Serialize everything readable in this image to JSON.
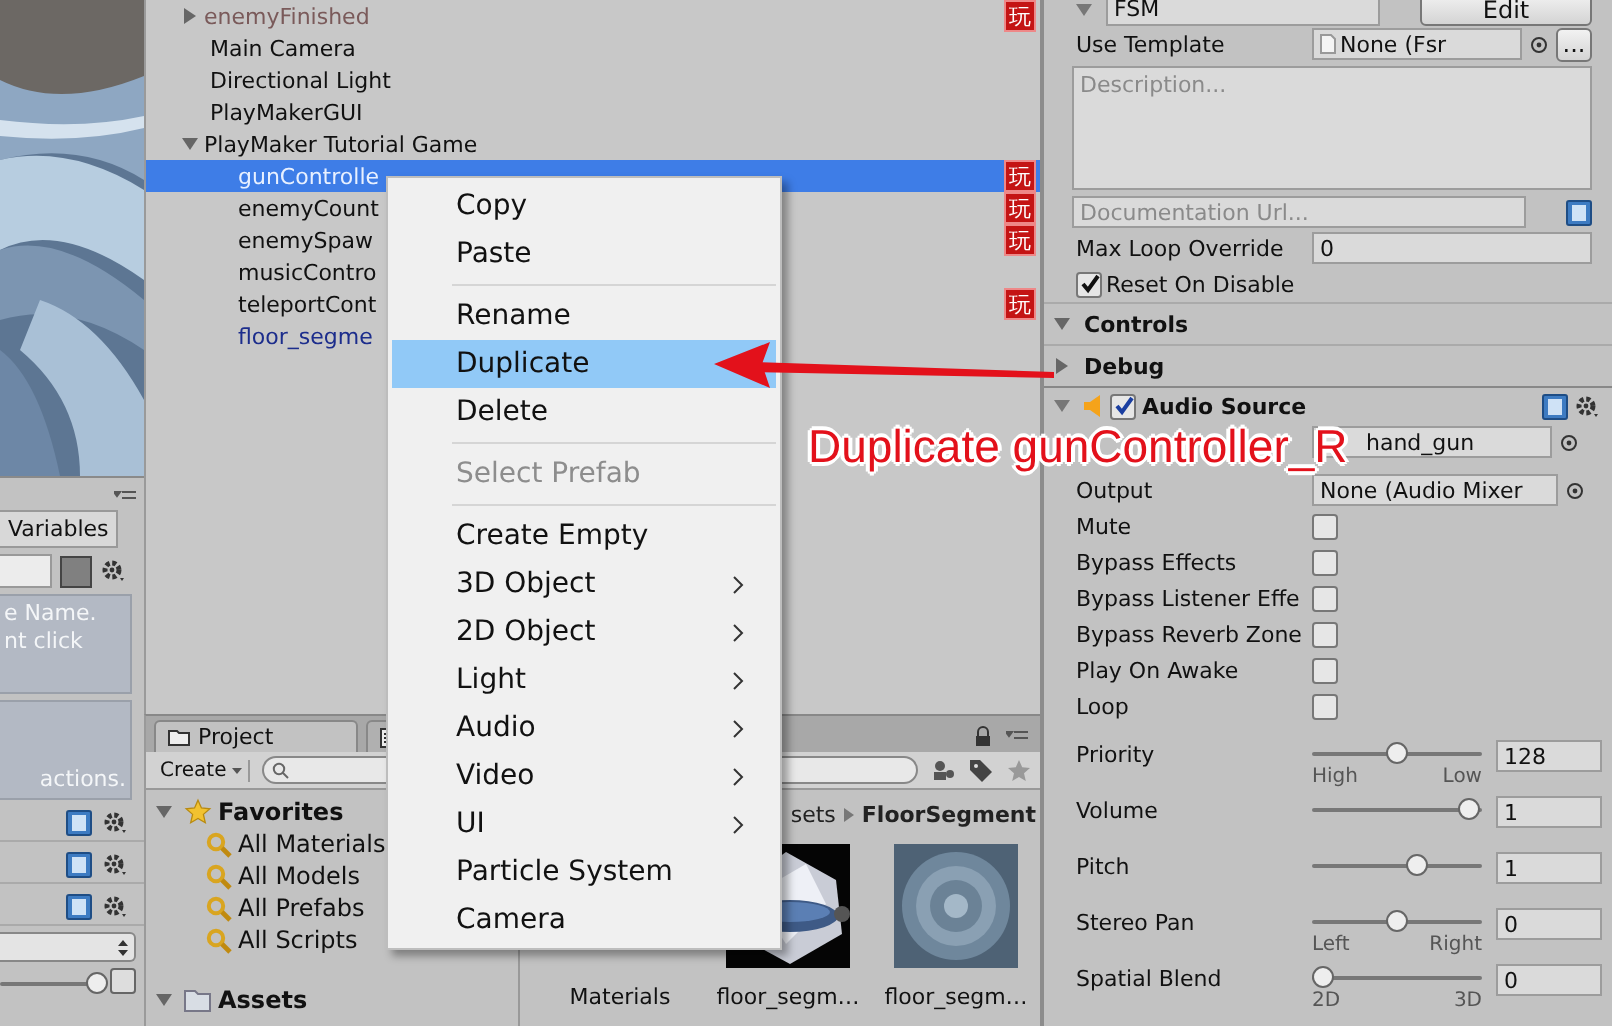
{
  "fsm_panel": {
    "tab": "Variables",
    "hint_lines": [
      "e Name.",
      "nt click"
    ],
    "actions_hint": "actions.",
    "slider": {
      "level": 1
    }
  },
  "hierarchy": {
    "rows": [
      {
        "label": "enemyFinished",
        "kind": "inactive",
        "expanded": false,
        "selected": false,
        "badge": "玩"
      },
      {
        "label": "Main Camera",
        "kind": "object",
        "selected": false
      },
      {
        "label": "Directional Light",
        "kind": "object",
        "selected": false
      },
      {
        "label": "PlayMakerGUI",
        "kind": "object",
        "selected": false
      },
      {
        "label": "PlayMaker Tutorial Game",
        "kind": "object",
        "expanded": true,
        "selected": false,
        "children": [
          {
            "label": "gunControlle",
            "kind": "object",
            "selected": true,
            "badge": "玩"
          },
          {
            "label": "enemyCount",
            "kind": "object",
            "selected": false,
            "badge": "玩"
          },
          {
            "label": "enemySpaw",
            "kind": "object",
            "selected": false,
            "badge": "玩"
          },
          {
            "label": "musicContro",
            "kind": "object",
            "selected": false
          },
          {
            "label": "teleportCont",
            "kind": "object",
            "selected": false,
            "badge": "玩"
          },
          {
            "label": "floor_segme",
            "kind": "prefab",
            "selected": false
          }
        ]
      }
    ]
  },
  "context_menu": {
    "groups": [
      [
        {
          "label": "Copy",
          "selected": false,
          "disabled": false,
          "submenu": false
        },
        {
          "label": "Paste",
          "selected": false,
          "disabled": false,
          "submenu": false
        }
      ],
      [
        {
          "label": "Rename",
          "selected": false,
          "disabled": false,
          "submenu": false
        },
        {
          "label": "Duplicate",
          "selected": true,
          "disabled": false,
          "submenu": false
        },
        {
          "label": "Delete",
          "selected": false,
          "disabled": false,
          "submenu": false
        }
      ],
      [
        {
          "label": "Select Prefab",
          "selected": false,
          "disabled": true,
          "submenu": false
        }
      ],
      [
        {
          "label": "Create Empty",
          "selected": false,
          "disabled": false,
          "submenu": false
        },
        {
          "label": "3D Object",
          "selected": false,
          "disabled": false,
          "submenu": true
        },
        {
          "label": "2D Object",
          "selected": false,
          "disabled": false,
          "submenu": true
        },
        {
          "label": "Light",
          "selected": false,
          "disabled": false,
          "submenu": true
        },
        {
          "label": "Audio",
          "selected": false,
          "disabled": false,
          "submenu": true
        },
        {
          "label": "Video",
          "selected": false,
          "disabled": false,
          "submenu": true
        },
        {
          "label": "UI",
          "selected": false,
          "disabled": false,
          "submenu": true
        },
        {
          "label": "Particle System",
          "selected": false,
          "disabled": false,
          "submenu": false
        },
        {
          "label": "Camera",
          "selected": false,
          "disabled": false,
          "submenu": false
        }
      ]
    ]
  },
  "annotation": {
    "text": "Duplicate gunController_R"
  },
  "project": {
    "tabs": [
      {
        "kind": "text",
        "label": "Project",
        "selected": true
      },
      {
        "kind": "icon",
        "selected": false
      }
    ],
    "create_button": "Create",
    "tree": [
      {
        "label": "Favorites",
        "kind": "favorites",
        "expanded": true,
        "children": [
          {
            "label": "All Materials"
          },
          {
            "label": "All Models"
          },
          {
            "label": "All Prefabs"
          },
          {
            "label": "All Scripts"
          }
        ]
      },
      {
        "label": "Assets",
        "kind": "folder",
        "expanded": true
      }
    ],
    "breadcrumb": [
      "sets",
      "FloorSegment"
    ],
    "assets": [
      {
        "label": "Materials",
        "kind": "folder"
      },
      {
        "label": "floor_segm…",
        "kind": "model"
      },
      {
        "label": "floor_segm…",
        "kind": "texture"
      }
    ]
  },
  "inspector": {
    "fsm": {
      "name": "FSM",
      "edit_button": "Edit",
      "template_label": "Use Template",
      "template_value": "None (Fsr",
      "template_button": "...",
      "description_placeholder": "Description...",
      "doc_url_placeholder": "Documentation Url...",
      "max_loop_label": "Max Loop Override",
      "max_loop_value": "0",
      "reset_label": "Reset On Disable",
      "reset_checked": true
    },
    "sections": [
      {
        "label": "Controls",
        "expanded": true
      },
      {
        "label": "Debug",
        "expanded": false
      }
    ],
    "audio_source": {
      "title": "Audio Source",
      "enabled": true,
      "clip_value": "hand_gun",
      "output_label": "Output",
      "output_value": "None (Audio Mixer",
      "toggles": [
        {
          "label": "Mute",
          "checked": false
        },
        {
          "label": "Bypass Effects",
          "checked": false
        },
        {
          "label": "Bypass Listener Effe",
          "checked": false
        },
        {
          "label": "Bypass Reverb Zone",
          "checked": false
        },
        {
          "label": "Play On Awake",
          "checked": false
        },
        {
          "label": "Loop",
          "checked": false
        }
      ],
      "sliders": [
        {
          "label": "Priority",
          "level": 0.5,
          "value": "128",
          "min_label": "High",
          "max_label": "Low"
        },
        {
          "label": "Volume",
          "level": 1,
          "value": "1"
        },
        {
          "label": "Pitch",
          "level": 0.65,
          "value": "1"
        },
        {
          "label": "Stereo Pan",
          "level": 0.5,
          "value": "0",
          "min_label": "Left",
          "max_label": "Right"
        },
        {
          "label": "Spatial Blend",
          "level": 0,
          "value": "0",
          "min_label": "2D",
          "max_label": "3D"
        }
      ]
    }
  }
}
